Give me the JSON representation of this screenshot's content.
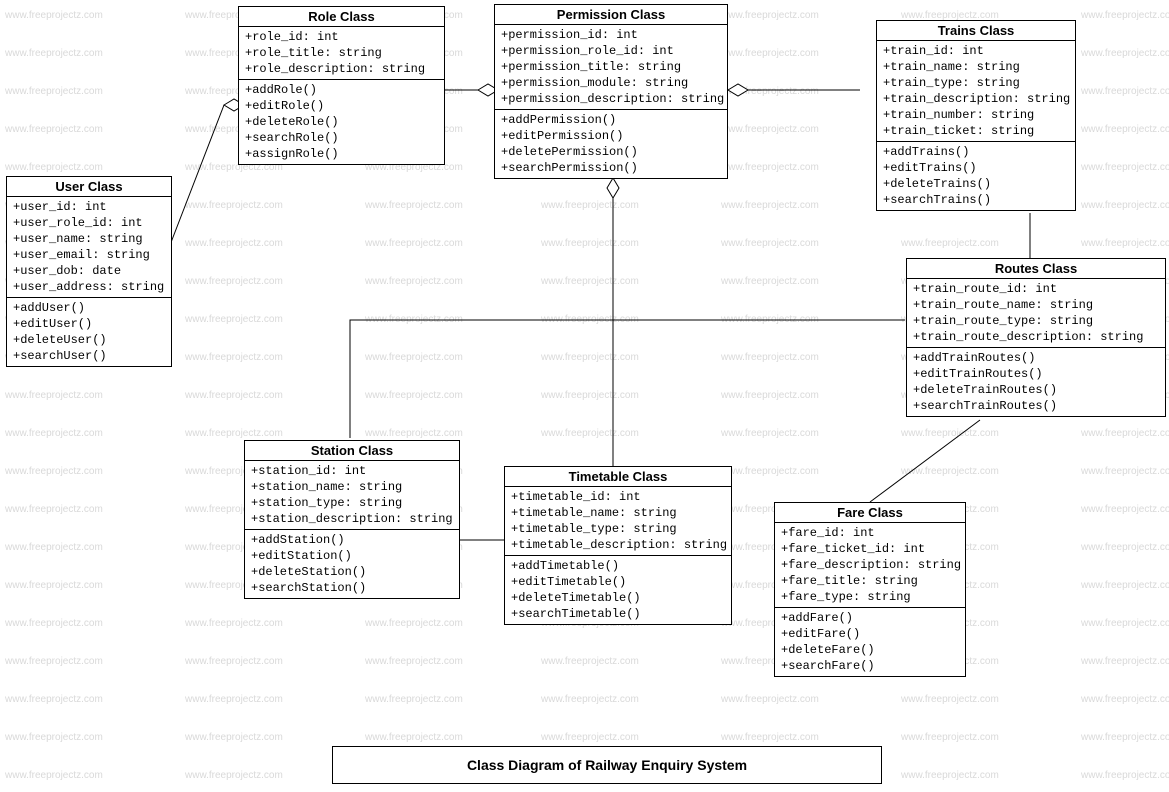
{
  "watermark_text": "www.freeprojectz.com",
  "title": "Class Diagram of Railway Enquiry System",
  "classes": {
    "user": {
      "name": "User Class",
      "attrs": [
        "+user_id: int",
        "+user_role_id: int",
        "+user_name: string",
        "+user_email: string",
        "+user_dob: date",
        "+user_address: string"
      ],
      "ops": [
        "+addUser()",
        "+editUser()",
        "+deleteUser()",
        "+searchUser()"
      ]
    },
    "role": {
      "name": "Role Class",
      "attrs": [
        "+role_id: int",
        "+role_title: string",
        "+role_description: string"
      ],
      "ops": [
        "+addRole()",
        "+editRole()",
        "+deleteRole()",
        "+searchRole()",
        "+assignRole()"
      ]
    },
    "permission": {
      "name": "Permission Class",
      "attrs": [
        "+permission_id: int",
        "+permission_role_id: int",
        "+permission_title: string",
        "+permission_module: string",
        "+permission_description: string"
      ],
      "ops": [
        "+addPermission()",
        "+editPermission()",
        "+deletePermission()",
        "+searchPermission()"
      ]
    },
    "trains": {
      "name": "Trains Class",
      "attrs": [
        "+train_id: int",
        "+train_name: string",
        "+train_type: string",
        "+train_description: string",
        "+train_number: string",
        "+train_ticket: string"
      ],
      "ops": [
        "+addTrains()",
        "+editTrains()",
        "+deleteTrains()",
        "+searchTrains()"
      ]
    },
    "routes": {
      "name": "Routes Class",
      "attrs": [
        "+train_route_id: int",
        "+train_route_name: string",
        "+train_route_type: string",
        "+train_route_description: string"
      ],
      "ops": [
        "+addTrainRoutes()",
        "+editTrainRoutes()",
        "+deleteTrainRoutes()",
        "+searchTrainRoutes()"
      ]
    },
    "station": {
      "name": "Station Class",
      "attrs": [
        "+station_id: int",
        "+station_name: string",
        "+station_type: string",
        "+station_description: string"
      ],
      "ops": [
        "+addStation()",
        "+editStation()",
        "+deleteStation()",
        "+searchStation()"
      ]
    },
    "timetable": {
      "name": "Timetable Class",
      "attrs": [
        "+timetable_id: int",
        "+timetable_name: string",
        "+timetable_type: string",
        "+timetable_description: string"
      ],
      "ops": [
        "+addTimetable()",
        "+editTimetable()",
        "+deleteTimetable()",
        "+searchTimetable()"
      ]
    },
    "fare": {
      "name": "Fare Class",
      "attrs": [
        "+fare_id: int",
        "+fare_ticket_id: int",
        "+fare_description: string",
        "+fare_title: string",
        "+fare_type: string"
      ],
      "ops": [
        "+addFare()",
        "+editFare()",
        "+deleteFare()",
        "+searchFare()"
      ]
    }
  }
}
